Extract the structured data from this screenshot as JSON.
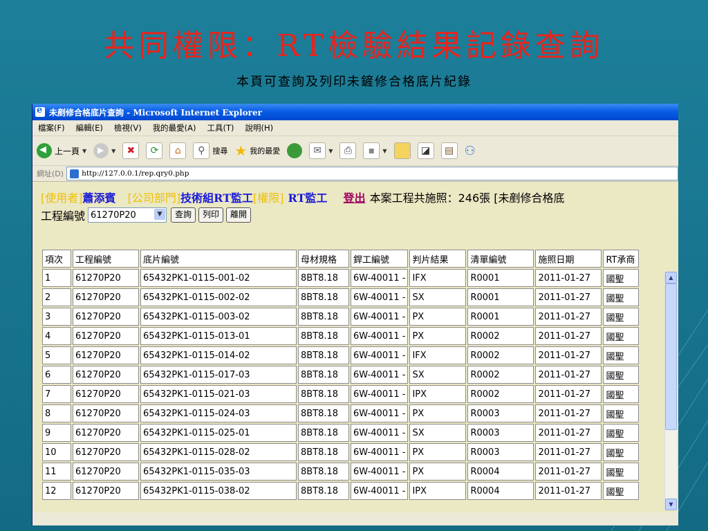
{
  "slide": {
    "title": "共同權限：RT檢驗結果記錄查詢",
    "subtitle": "本頁可查詢及列印未鏟修合格底片紀錄"
  },
  "window": {
    "title": "未剷修合格底片查詢 - Microsoft Internet Explorer",
    "menu": [
      "檔案(F)",
      "編輯(E)",
      "檢視(V)",
      "我的最愛(A)",
      "工具(T)",
      "說明(H)"
    ],
    "toolbar": {
      "back": "上一頁",
      "search": "搜尋",
      "favorites": "我的最愛"
    },
    "address_label": "網址(D)",
    "address": "http://127.0.0.1/rep.qry0.php"
  },
  "info": {
    "user_label": "[使用者]",
    "user": "蕭添賓",
    "dept_label": "[公司部門]",
    "dept": "技術組RT監工",
    "perm_label": "[權限]",
    "perm": "RT監工",
    "logout": "登出",
    "summary": "本案工程共施照：246張 [未剷修合格底"
  },
  "controls": {
    "project_label": "工程編號",
    "project_value": "61270P20",
    "query": "查詢",
    "print": "列印",
    "leave": "離開"
  },
  "table": {
    "headers": [
      "項次",
      "工程編號",
      "底片編號",
      "母材規格",
      "銲工編號",
      "判片結果",
      "清單編號",
      "施照日期",
      "RT承商"
    ],
    "rows": [
      [
        "1",
        "61270P20",
        "65432PK1-0115-001-02",
        "8BT8.18",
        "6W-40011 -",
        "IFX",
        "R0001",
        "2011-01-27",
        "國聖"
      ],
      [
        "2",
        "61270P20",
        "65432PK1-0115-002-02",
        "8BT8.18",
        "6W-40011 -",
        "SX",
        "R0001",
        "2011-01-27",
        "國聖"
      ],
      [
        "3",
        "61270P20",
        "65432PK1-0115-003-02",
        "8BT8.18",
        "6W-40011 -",
        "PX",
        "R0001",
        "2011-01-27",
        "國聖"
      ],
      [
        "4",
        "61270P20",
        "65432PK1-0115-013-01",
        "8BT8.18",
        "6W-40011 -",
        "PX",
        "R0002",
        "2011-01-27",
        "國聖"
      ],
      [
        "5",
        "61270P20",
        "65432PK1-0115-014-02",
        "8BT8.18",
        "6W-40011 -",
        "IFX",
        "R0002",
        "2011-01-27",
        "國聖"
      ],
      [
        "6",
        "61270P20",
        "65432PK1-0115-017-03",
        "8BT8.18",
        "6W-40011 -",
        "SX",
        "R0002",
        "2011-01-27",
        "國聖"
      ],
      [
        "7",
        "61270P20",
        "65432PK1-0115-021-03",
        "8BT8.18",
        "6W-40011 -",
        "IPX",
        "R0002",
        "2011-01-27",
        "國聖"
      ],
      [
        "8",
        "61270P20",
        "65432PK1-0115-024-03",
        "8BT8.18",
        "6W-40011 -",
        "PX",
        "R0003",
        "2011-01-27",
        "國聖"
      ],
      [
        "9",
        "61270P20",
        "65432PK1-0115-025-01",
        "8BT8.18",
        "6W-40011 -",
        "SX",
        "R0003",
        "2011-01-27",
        "國聖"
      ],
      [
        "10",
        "61270P20",
        "65432PK1-0115-028-02",
        "8BT8.18",
        "6W-40011 -",
        "PX",
        "R0003",
        "2011-01-27",
        "國聖"
      ],
      [
        "11",
        "61270P20",
        "65432PK1-0115-035-03",
        "8BT8.18",
        "6W-40011 -",
        "PX",
        "R0004",
        "2011-01-27",
        "國聖"
      ],
      [
        "12",
        "61270P20",
        "65432PK1-0115-038-02",
        "8BT8.18",
        "6W-40011 -",
        "IPX",
        "R0004",
        "2011-01-27",
        "國聖"
      ]
    ]
  }
}
